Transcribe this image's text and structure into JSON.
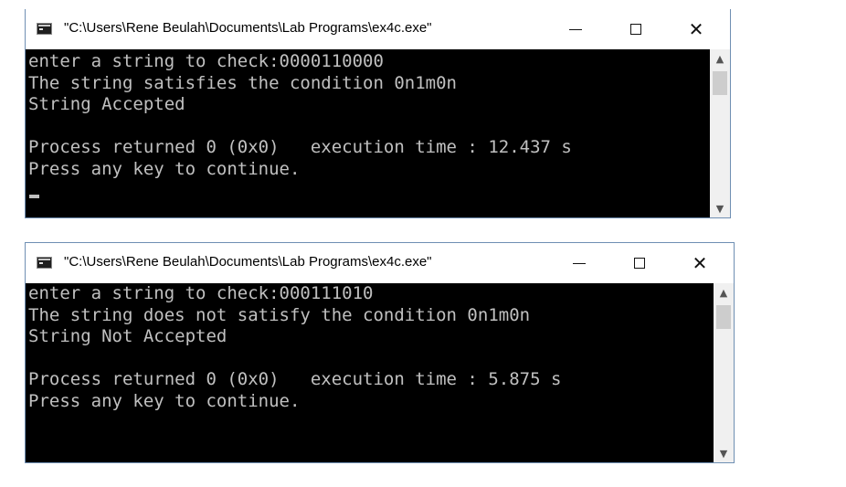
{
  "windows": [
    {
      "title": "\"C:\\Users\\Rene Beulah\\Documents\\Lab Programs\\ex4c.exe\"",
      "lines": [
        "enter a string to check:0000110000",
        "The string satisfies the condition 0n1m0n",
        "String Accepted",
        "",
        "Process returned 0 (0x0)   execution time : 12.437 s",
        "Press any key to continue."
      ]
    },
    {
      "title": "\"C:\\Users\\Rene Beulah\\Documents\\Lab Programs\\ex4c.exe\"",
      "lines": [
        "enter a string to check:000111010",
        "The string does not satisfy the condition 0n1m0n",
        "String Not Accepted",
        "",
        "Process returned 0 (0x0)   execution time : 5.875 s",
        "Press any key to continue."
      ]
    }
  ],
  "controls": {
    "minimize": "minimize-icon",
    "maximize": "maximize-icon",
    "close": "✕"
  },
  "colors": {
    "console_bg": "#000000",
    "console_text": "#c0c0c0"
  }
}
